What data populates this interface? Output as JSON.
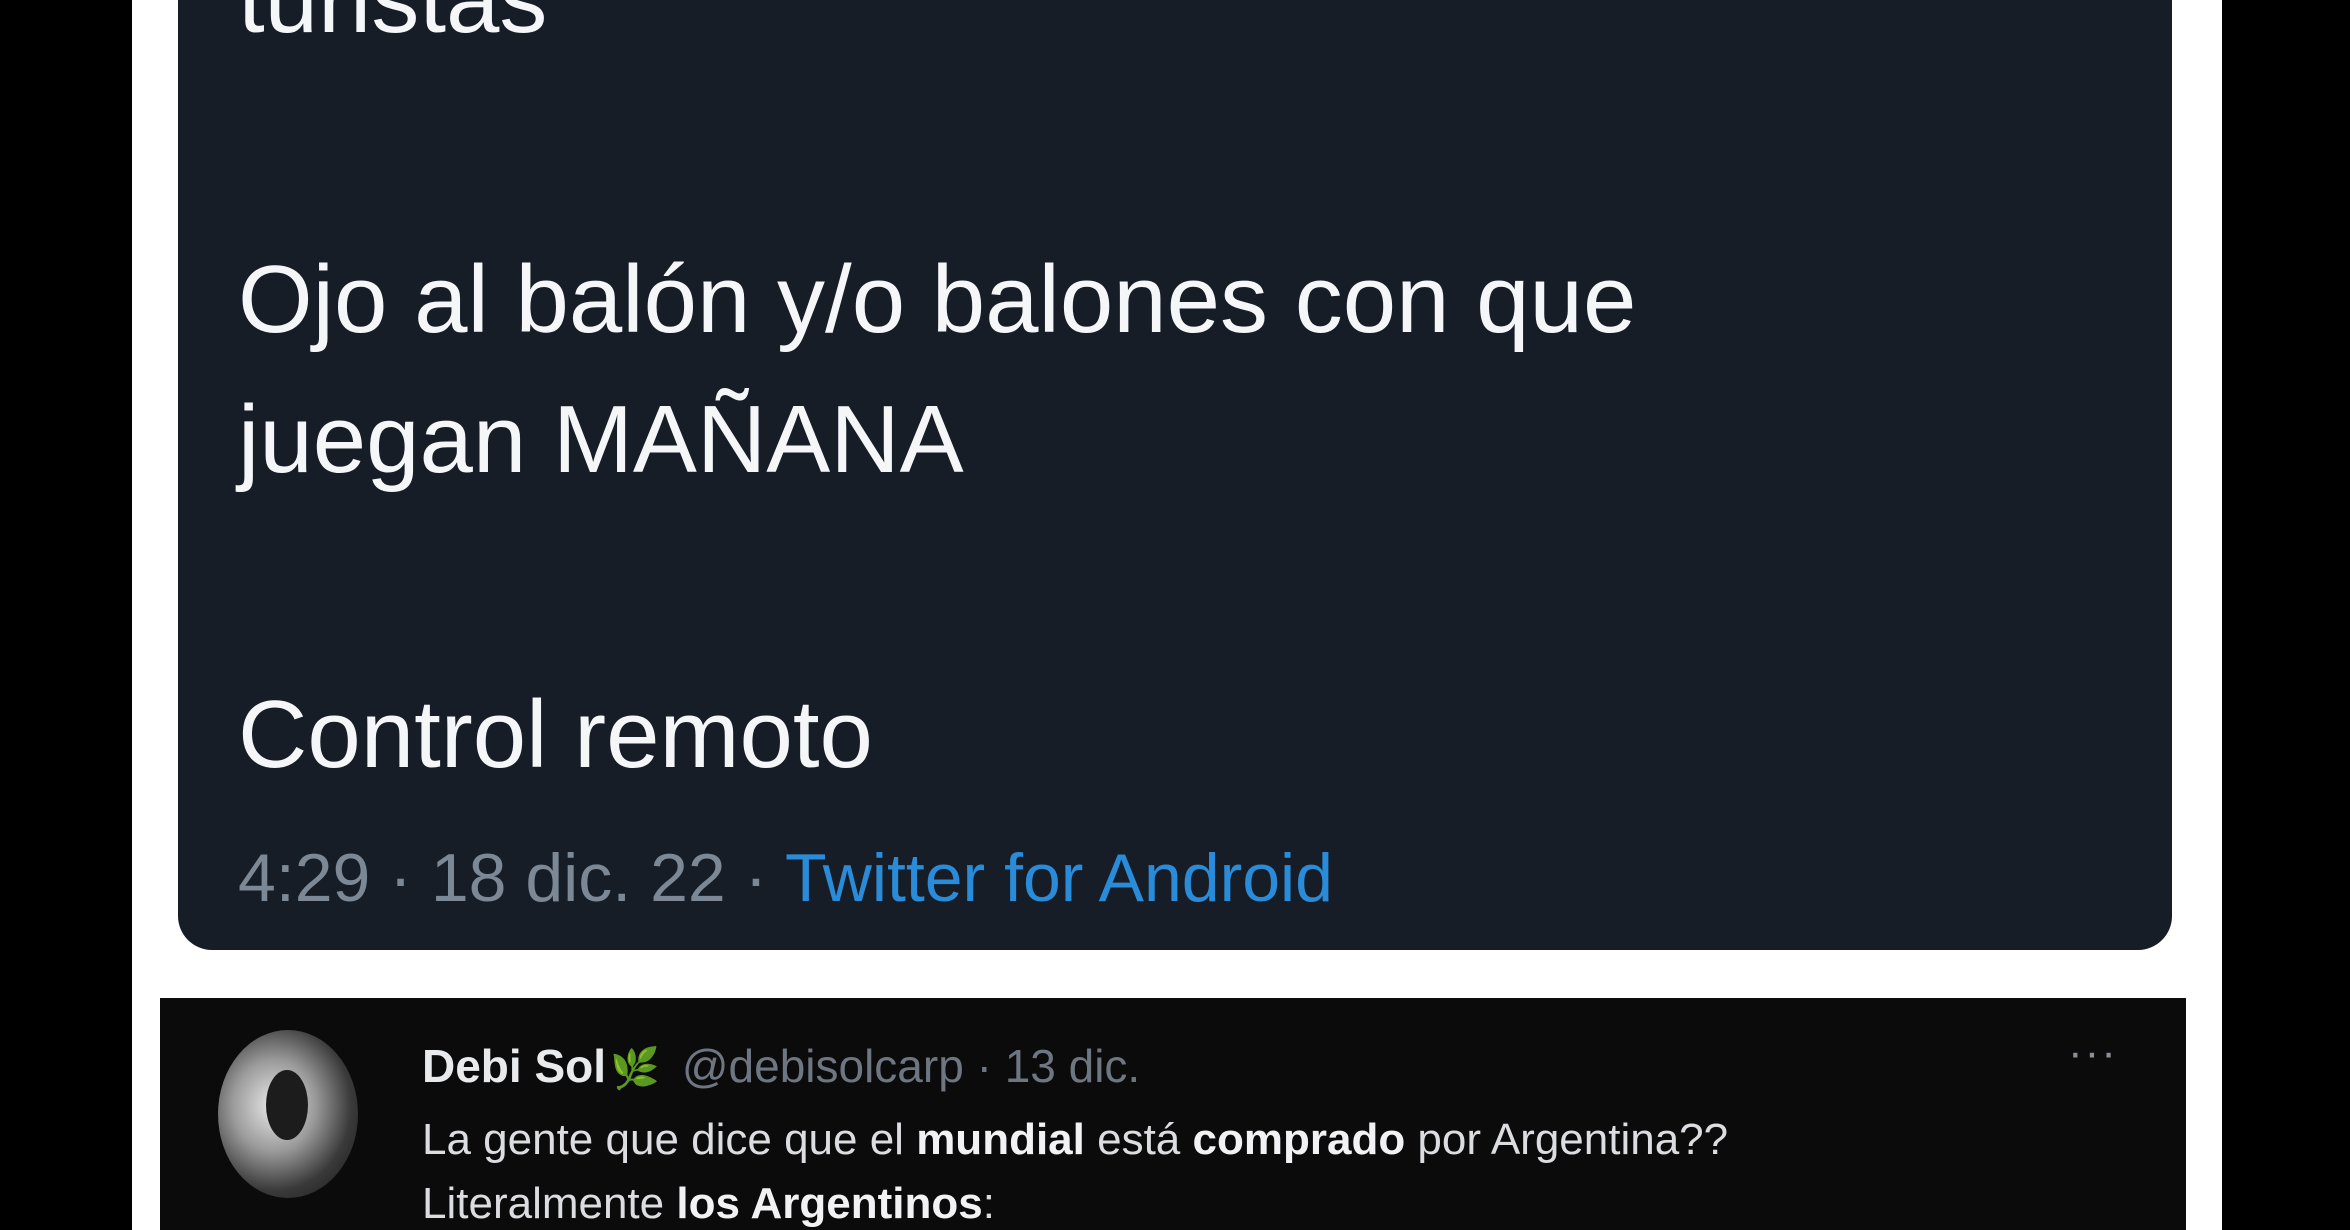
{
  "tweet": {
    "text_cut_line": "turistas",
    "text_line_1": "Ojo al balón y/o balones con que",
    "text_line_2": "juegan MAÑANA",
    "text_line_3": "Control remoto",
    "time": "4:29",
    "date": "18 dic. 22",
    "source": "Twitter for Android",
    "separator": "·"
  },
  "reply": {
    "name": "Debi Sol",
    "handle": "@debisolcarp",
    "date": "13 dic.",
    "separator": "·",
    "line1": {
      "p1": "La gente que dice que el ",
      "b1": "mundial",
      "p2": " está ",
      "b2": "comprado",
      "p3": " por Argentina??"
    },
    "line2": {
      "p1": "Literalmente ",
      "b1": "los Argentinos",
      "p2": ":"
    },
    "more_label": "···"
  },
  "icons": {
    "leaf": "leaf-icon",
    "more": "more-icon",
    "avatar": "avatar"
  },
  "colors": {
    "tweet_bg": "#161d27",
    "link": "#2a8bd8",
    "meta": "#7c8896"
  }
}
